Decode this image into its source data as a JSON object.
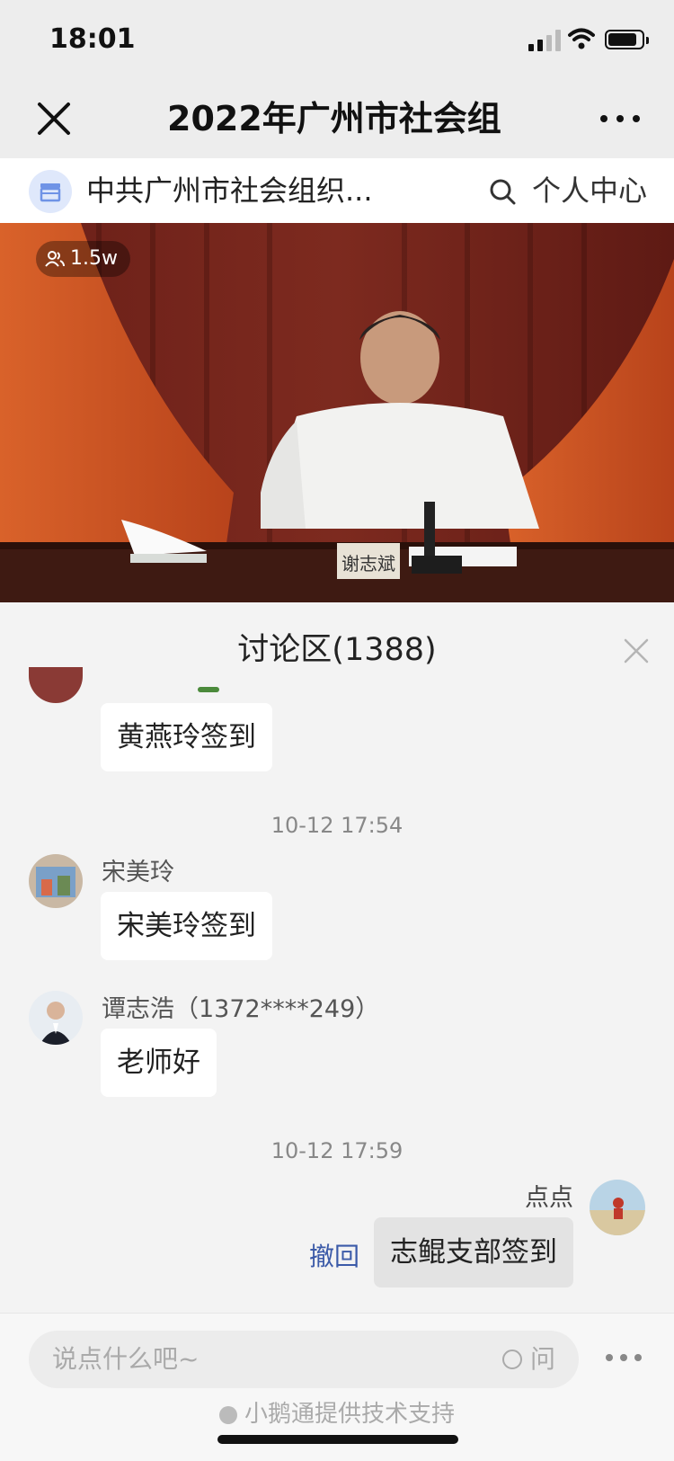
{
  "status_bar": {
    "time": "18:01"
  },
  "nav": {
    "title": "2022年广州市社会组",
    "channel_name": "中共广州市社会组织...",
    "personal_center": "个人中心"
  },
  "live": {
    "viewer_count": "1.5w",
    "nameplate": "谢志斌"
  },
  "discussion": {
    "title": "讨论区(1388)",
    "messages": [
      {
        "text": "黄燕玲签到"
      },
      {
        "timestamp": "10-12 17:54"
      },
      {
        "user": "宋美玲",
        "text": "宋美玲签到"
      },
      {
        "user": "谭志浩（1372****249）",
        "text": "老师好"
      },
      {
        "timestamp": "10-12 17:59"
      },
      {
        "user": "点点",
        "text": "志鲲支部签到",
        "recall_label": "撤回"
      }
    ]
  },
  "input": {
    "placeholder": "说点什么吧~",
    "ask_label": "问",
    "powered_by": "小鹅通提供技术支持"
  },
  "colors": {
    "link_blue": "#3b5aa8",
    "background": "#f3f3f3"
  }
}
